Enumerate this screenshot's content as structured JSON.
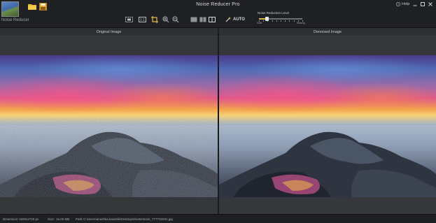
{
  "app": {
    "title": "Noise Reducer Pro",
    "logo_label": "Noise Reducer"
  },
  "toolbar": {
    "auto_label": "AUTO",
    "noise_reduction_label": "Noise Reduction Level",
    "slider_min_label": "Soft",
    "slider_max_label": "Strong",
    "slider_value_fraction": 0.18,
    "slider_color": "#d8b24a"
  },
  "window": {
    "help_label": "Help"
  },
  "panels": {
    "left_title": "Original Image",
    "right_title": "Denoised Image"
  },
  "status": {
    "dimension_label": "Dimension:",
    "dimension_value": "1500x2720 px",
    "size_label": "Size:",
    "size_value": "16.00 MB",
    "path_label": "Path:",
    "path_value": "C:\\Users\\anushka.kaushik\\Desktop\\shutterstock_777733291.jpg"
  },
  "icons": [
    "app-logo",
    "open-folder-icon",
    "save-icon",
    "fit-screen-icon",
    "actual-size-icon",
    "crop-icon",
    "zoom-in-icon",
    "zoom-out-icon",
    "single-view-icon",
    "split-view-icon",
    "side-by-side-icon",
    "magic-wand-icon",
    "help-icon",
    "minimize-icon",
    "maximize-icon",
    "close-icon"
  ],
  "colors": {
    "accent": "#d8b24a",
    "background": "#2b2d31",
    "titlebar": "#1f2024"
  }
}
